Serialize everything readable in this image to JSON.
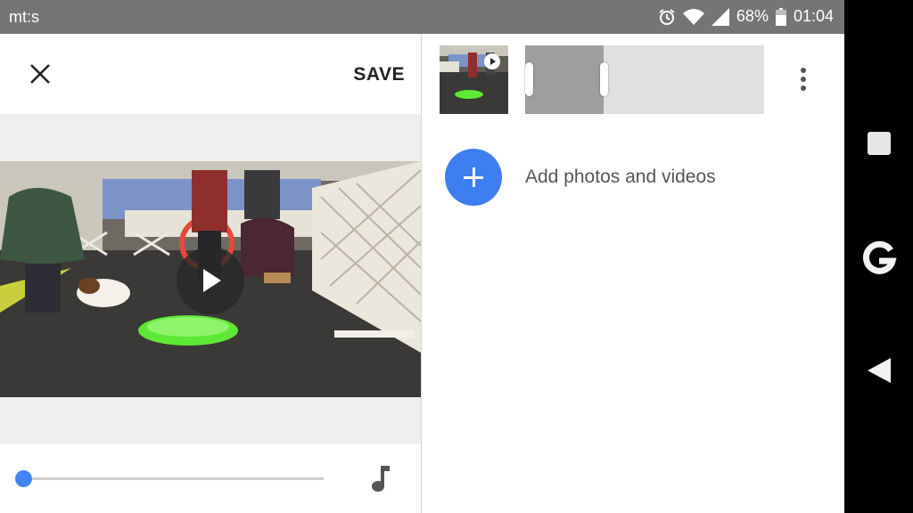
{
  "status_bar": {
    "carrier": "mt:s",
    "battery_percent": "68%",
    "time": "01:04",
    "icons": [
      "alarm-icon",
      "wifi-icon",
      "signal-icon",
      "battery-icon"
    ]
  },
  "editor": {
    "close_icon": "close-icon",
    "save_label": "SAVE",
    "playback_progress": 0.0,
    "music_icon": "music-note-icon"
  },
  "timeline": {
    "trim_start": 0.0,
    "trim_end": 0.33,
    "more_icon": "more-vert-icon",
    "add_label": "Add photos and videos"
  },
  "nav_bar": {
    "icons": [
      "recents-icon",
      "google-icon",
      "back-icon"
    ]
  },
  "colors": {
    "status_bar": "#757575",
    "accent": "#3d7ff0",
    "seek_thumb": "#4285f4",
    "video_disc": "#5ee836"
  }
}
